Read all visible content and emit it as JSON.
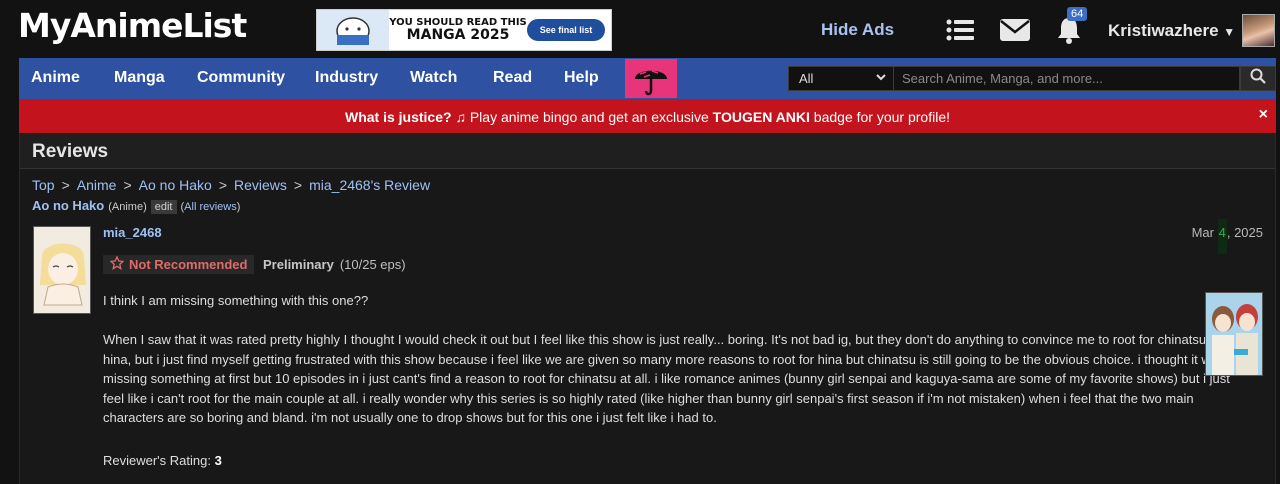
{
  "header": {
    "logo": "MyAnimeList",
    "ad": {
      "line1": "YOU SHOULD READ THIS",
      "line2": "MANGA 2025",
      "button": "See final list"
    },
    "hide_ads": "Hide Ads",
    "notification_count": "64",
    "username": "Kristiwazhere"
  },
  "nav": {
    "items": [
      "Anime",
      "Manga",
      "Community",
      "Industry",
      "Watch",
      "Read",
      "Help"
    ],
    "search_category": "All",
    "search_placeholder": "Search Anime, Manga, and more..."
  },
  "promo": {
    "bold1": "What is justice?",
    "text1": " Play anime bingo and get an exclusive ",
    "bold2": "TOUGEN ANKI",
    "text2": " badge for your profile!",
    "close": "×"
  },
  "page": {
    "title": "Reviews",
    "breadcrumb": [
      "Top",
      "Anime",
      "Ao no Hako",
      "Reviews",
      "mia_2468's Review"
    ],
    "subject_title": "Ao no Hako",
    "subject_type": "(Anime)",
    "edit_label": "edit",
    "all_reviews_label": "All reviews"
  },
  "review": {
    "reviewer": "mia_2468",
    "date_month": "Mar",
    "date_day": "4",
    "date_year": ", 2025",
    "recommendation": "Not Recommended",
    "status": "Preliminary",
    "episodes": "(10/25 eps)",
    "paragraph1": "I think I am missing something with this one??",
    "paragraph2": "When I saw that it was rated pretty highly I thought I would check it out but I feel like this show is just really... boring. It's not bad ig, but they don't do anything to convince me to root for chinatsu. i like hina, but i just find myself getting frustrated with this show because i feel like we are given so many more reasons to root for hina but chinatsu is still going to be the obvious choice. i thought it was just missing something at first but 10 episodes in i just cant's find a reason to root for chinatsu at all. i like romance animes (bunny girl senpai and kaguya-sama are some of my favorite shows) but i just feel like i can't root for the main couple at all. i really wonder why this series is so highly rated (like higher than bunny girl senpai's first season if i'm not mistaken) when i feel that the two main characters are so boring and bland. i'm not usually one to drop shows but for this one i just felt like i had to.",
    "rating_label": "Reviewer's Rating:",
    "rating_value": "3"
  },
  "colors": {
    "nav_bg": "#2e51a2",
    "promo_bg": "#c3141d",
    "link": "#9fc1f2",
    "not_recommended": "#e06b6b"
  }
}
